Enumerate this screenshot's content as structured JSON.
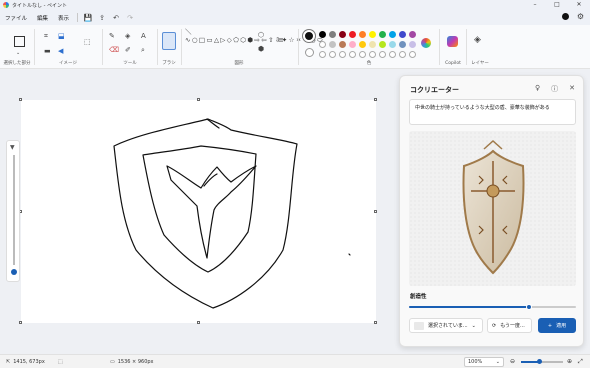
{
  "window": {
    "title": "タイトルなし - ペイント"
  },
  "menu": {
    "file": "ファイル",
    "edit": "編集",
    "view": "表示"
  },
  "ribbon": {
    "groups": {
      "selection": "選択した部分",
      "image": "イメージ",
      "tools": "ツール",
      "brushes": "ブラシ",
      "shapes": "図形",
      "colors": "色",
      "copilot": "Copilot",
      "layers": "レイヤー"
    },
    "shapes_glyphs": "＼∿○□▭△▷◇⬠⬡⬢⇨⇦⇧⇩✦☆✶♡◔⬭",
    "palette": [
      "#000000",
      "#7f7f7f",
      "#880015",
      "#ed1c24",
      "#ff7f27",
      "#fff200",
      "#22b14c",
      "#00a2e8",
      "#3f48cc",
      "#a349a4",
      "#ffffff",
      "#c3c3c3",
      "#b97a57",
      "#ffaec9",
      "#ffc90e",
      "#efe4b0",
      "#b5e61d",
      "#99d9ea",
      "#7092be",
      "#c8bfe7"
    ]
  },
  "cocreator": {
    "title": "コクリエーター",
    "prompt": "中世の騎士が持っているような大型の盾、豪華な装飾がある",
    "creativity_label": "創造性",
    "creativity_value": 0.72,
    "style_button": "選択されていま...",
    "retry_button": "もう一度...",
    "apply_button": "適用"
  },
  "status": {
    "cursor": "1415, 673px",
    "canvas_size": "1536 × 960px",
    "zoom": "100%"
  }
}
